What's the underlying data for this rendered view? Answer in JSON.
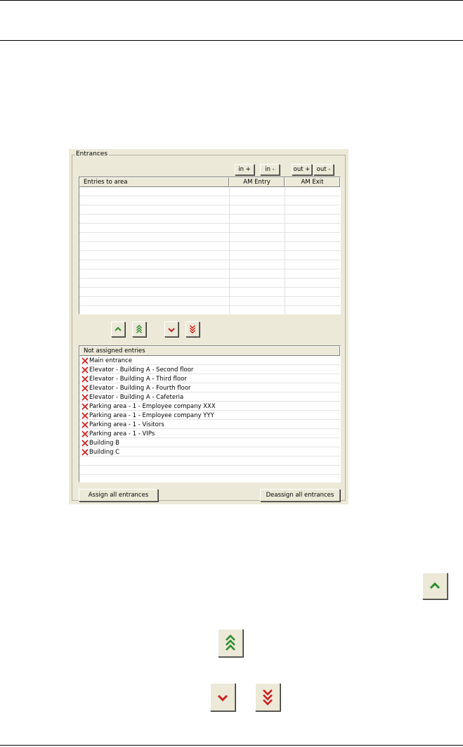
{
  "panel": {
    "group_title": "Entrances",
    "buttons": {
      "in_plus": "in +",
      "in_minus": "in -",
      "out_plus": "out +",
      "out_minus": "out -"
    },
    "entries_table": {
      "columns": [
        "Entries to area",
        "AM Entry",
        "AM Exit"
      ]
    },
    "not_assigned": {
      "header": "Not assigned entries",
      "items": [
        "Main entrance",
        "Elevator - Building A - Second floor",
        "Elevator - Building A - Third floor",
        "Elevator - Building A - Fourth floor",
        "Elevator - Building A - Cafeteria",
        "Parking area - 1 - Employee company XXX",
        "Parking area - 1 - Employee company YYY",
        "Parking area - 1 - Visitors",
        "Parking area - 1 - VIPs",
        "Building B",
        "Building C"
      ]
    },
    "assign_all": "Assign all entrances",
    "deassign_all": "Deassign all entrances"
  },
  "icons": {
    "up": "chevron-up-icon",
    "up_all": "double-chevron-up-icon",
    "down": "chevron-down-icon",
    "down_all": "double-chevron-down-icon"
  },
  "colors": {
    "up_arrow": "#2e8b2e",
    "down_arrow": "#cc1f1f",
    "x_mark": "#cc2020",
    "panel_bg": "#ece9d8"
  }
}
